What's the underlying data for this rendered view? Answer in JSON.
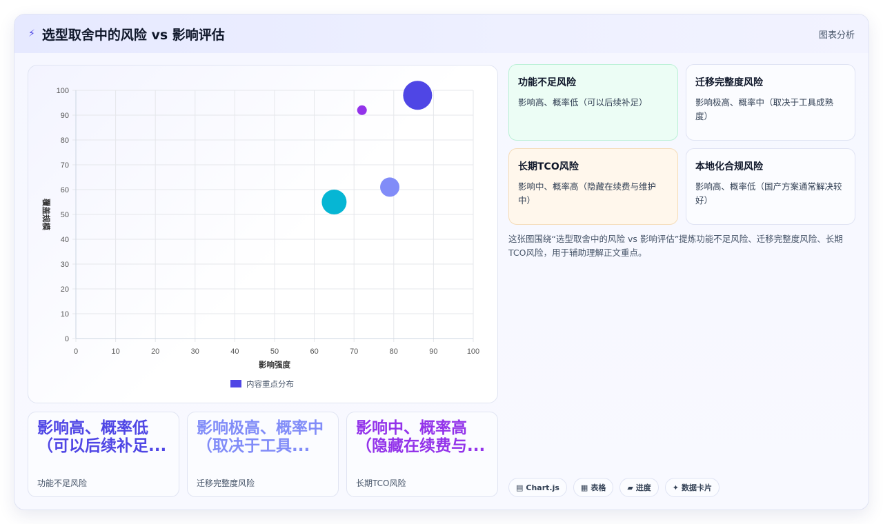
{
  "header": {
    "title": "选型取舍中的风险 vs 影响评估",
    "tag": "图表分析"
  },
  "chart_data": {
    "type": "bubble",
    "xlabel": "影响强度",
    "ylabel": "覆盖规模",
    "xlim": [
      0,
      100
    ],
    "ylim": [
      0,
      100
    ],
    "ticks": [
      0,
      10,
      20,
      30,
      40,
      50,
      60,
      70,
      80,
      90,
      100
    ],
    "legend": "内容重点分布",
    "legend_position": "bottom",
    "grid": true,
    "points": [
      {
        "x": 65,
        "y": 55,
        "r": 18,
        "color": "#06b6d4"
      },
      {
        "x": 79,
        "y": 61,
        "r": 14,
        "color": "#818cf8"
      },
      {
        "x": 86,
        "y": 98,
        "r": 21,
        "color": "#4f46e5"
      },
      {
        "x": 72,
        "y": 92,
        "r": 7,
        "color": "#9333ea"
      }
    ]
  },
  "stats": [
    {
      "value": "影响高、概率低（可以后续补足...",
      "caption": "功能不足风险",
      "color": "#4f46e5"
    },
    {
      "value": "影响极高、概率中（取决于工具...",
      "caption": "迁移完整度风险",
      "color": "#818cf8"
    },
    {
      "value": "影响中、概率高（隐藏在续费与...",
      "caption": "长期TCO风险",
      "color": "#9333ea"
    }
  ],
  "risks": [
    {
      "title": "功能不足风险",
      "desc": "影响高、概率低（可以后续补足）",
      "bg": "#ecfdf5",
      "border": "#bbf0d6"
    },
    {
      "title": "迁移完整度风险",
      "desc": "影响极高、概率中（取决于工具成熟度）",
      "bg": "#fbfcff",
      "border": "#dfe3f3"
    },
    {
      "title": "长期TCO风险",
      "desc": "影响中、概率高（隐藏在续费与维护中）",
      "bg": "#fff7ec",
      "border": "#f5dcb8"
    },
    {
      "title": "本地化合规风险",
      "desc": "影响高、概率低（国产方案通常解决较好）",
      "bg": "#fbfcff",
      "border": "#dfe3f3"
    }
  ],
  "description": "这张图围绕“选型取舍中的风险 vs 影响评估”提炼功能不足风险、迁移完整度风险、长期TCO风险，用于辅助理解正文重点。",
  "chips": [
    {
      "icon": "▤",
      "label": "Chart.js"
    },
    {
      "icon": "▦",
      "label": "表格"
    },
    {
      "icon": "▰",
      "label": "进度"
    },
    {
      "icon": "✦",
      "label": "数据卡片"
    }
  ]
}
